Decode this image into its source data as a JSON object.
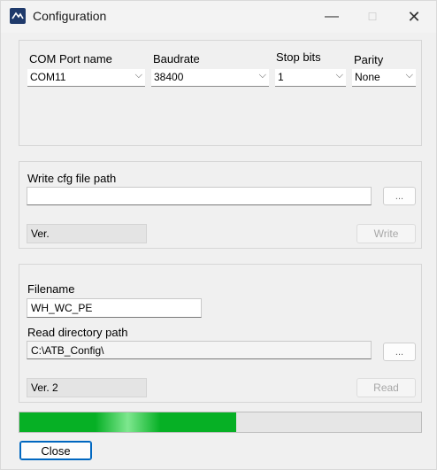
{
  "window": {
    "title": "Configuration",
    "controls": {
      "minimize": "—",
      "maximize": "☐",
      "close": "✕"
    }
  },
  "serial": {
    "com_port_label": "COM Port name",
    "com_port_value": "COM11",
    "baudrate_label": "Baudrate",
    "baudrate_value": "38400",
    "stop_bits_label": "Stop bits",
    "stop_bits_value": "1",
    "parity_label": "Parity",
    "parity_value": "None"
  },
  "write": {
    "path_label": "Write cfg file path",
    "path_value": "",
    "browse_label": "...",
    "version_value": "Ver.",
    "write_label": "Write"
  },
  "read": {
    "filename_label": "Filename",
    "filename_value": "WH_WC_PE",
    "dir_label": "Read directory path",
    "dir_value": "C:\\ATB_Config\\",
    "browse_label": "...",
    "version_value": "Ver. 2",
    "read_label": "Read"
  },
  "progress": {
    "fraction": 0.54
  },
  "footer": {
    "close_label": "Close"
  },
  "chevron": "⌵",
  "colors": {
    "progress_green": "#06b025",
    "focus_blue": "#0067c0"
  }
}
